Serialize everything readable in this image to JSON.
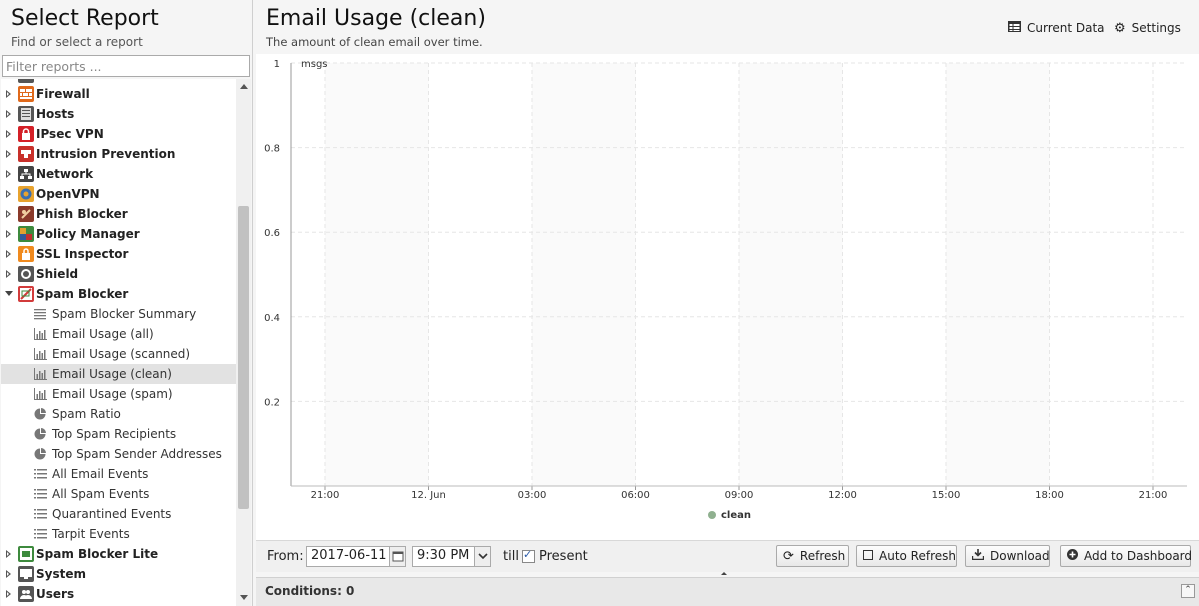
{
  "sidebar": {
    "title": "Select Report",
    "subtitle": "Find or select a report",
    "filter_placeholder": "Filter reports ...",
    "apps": [
      {
        "label": "Firewall",
        "icon": "firewall-icon",
        "color": "#e0691b"
      },
      {
        "label": "Hosts",
        "icon": "hosts-icon",
        "color": "#555555"
      },
      {
        "label": "IPsec VPN",
        "icon": "lock-icon",
        "color": "#d42027"
      },
      {
        "label": "Intrusion Prevention",
        "icon": "intrusion-prevention-icon",
        "color": "#c8302a"
      },
      {
        "label": "Network",
        "icon": "network-icon",
        "color": "#444444"
      },
      {
        "label": "OpenVPN",
        "icon": "openvpn-icon",
        "color": "#e8a32e"
      },
      {
        "label": "Phish Blocker",
        "icon": "phish-blocker-icon",
        "color": "#8a3a2a"
      },
      {
        "label": "Policy Manager",
        "icon": "policy-manager-icon",
        "color": "#3d8a3d"
      },
      {
        "label": "SSL Inspector",
        "icon": "ssl-inspector-icon",
        "color": "#f08a1e"
      },
      {
        "label": "Shield",
        "icon": "shield-icon",
        "color": "#555555"
      },
      {
        "label": "Spam Blocker",
        "icon": "spam-blocker-icon",
        "color": "#d23b3b"
      }
    ],
    "spam_reports": [
      {
        "label": "Spam Blocker Summary",
        "icon": "text-summary-icon"
      },
      {
        "label": "Email Usage (all)",
        "icon": "bar-chart-icon"
      },
      {
        "label": "Email Usage (scanned)",
        "icon": "bar-chart-icon"
      },
      {
        "label": "Email Usage (clean)",
        "icon": "bar-chart-icon"
      },
      {
        "label": "Email Usage (spam)",
        "icon": "bar-chart-icon"
      },
      {
        "label": "Spam Ratio",
        "icon": "pie-chart-icon"
      },
      {
        "label": "Top Spam Recipients",
        "icon": "pie-chart-icon"
      },
      {
        "label": "Top Spam Sender Addresses",
        "icon": "pie-chart-icon"
      },
      {
        "label": "All Email Events",
        "icon": "list-icon"
      },
      {
        "label": "All Spam Events",
        "icon": "list-icon"
      },
      {
        "label": "Quarantined Events",
        "icon": "list-icon"
      },
      {
        "label": "Tarpit Events",
        "icon": "list-icon"
      }
    ],
    "apps_after": [
      {
        "label": "Spam Blocker Lite",
        "icon": "spam-blocker-lite-icon",
        "color": "#3d8a3d"
      },
      {
        "label": "System",
        "icon": "system-icon",
        "color": "#555555"
      },
      {
        "label": "Users",
        "icon": "users-icon",
        "color": "#555555"
      }
    ]
  },
  "report": {
    "title": "Email Usage (clean)",
    "description": "The amount of clean email over time.",
    "current_data_label": "Current Data",
    "settings_label": "Settings"
  },
  "chart_data": {
    "type": "line",
    "title": "",
    "ylabel": "msgs",
    "ylim": [
      0,
      1
    ],
    "y_ticks": [
      "0.2",
      "0.4",
      "0.6",
      "0.8",
      "1"
    ],
    "x_ticks": [
      "21:00",
      "12. Jun",
      "03:00",
      "06:00",
      "09:00",
      "12:00",
      "15:00",
      "18:00",
      "21:00"
    ],
    "series": [
      {
        "name": "clean",
        "color": "#8fb08f",
        "values": []
      }
    ],
    "grid": true,
    "legend_position": "bottom-center"
  },
  "bottom": {
    "from_label": "From:",
    "from_date": "2017-06-11",
    "from_time": "9:30 PM",
    "till_label": "till",
    "present_label": "Present",
    "refresh_label": "Refresh",
    "auto_refresh_label": "Auto Refresh",
    "download_label": "Download",
    "add_dashboard_label": "Add to Dashboard"
  },
  "conditions": {
    "label": "Conditions: 0"
  }
}
